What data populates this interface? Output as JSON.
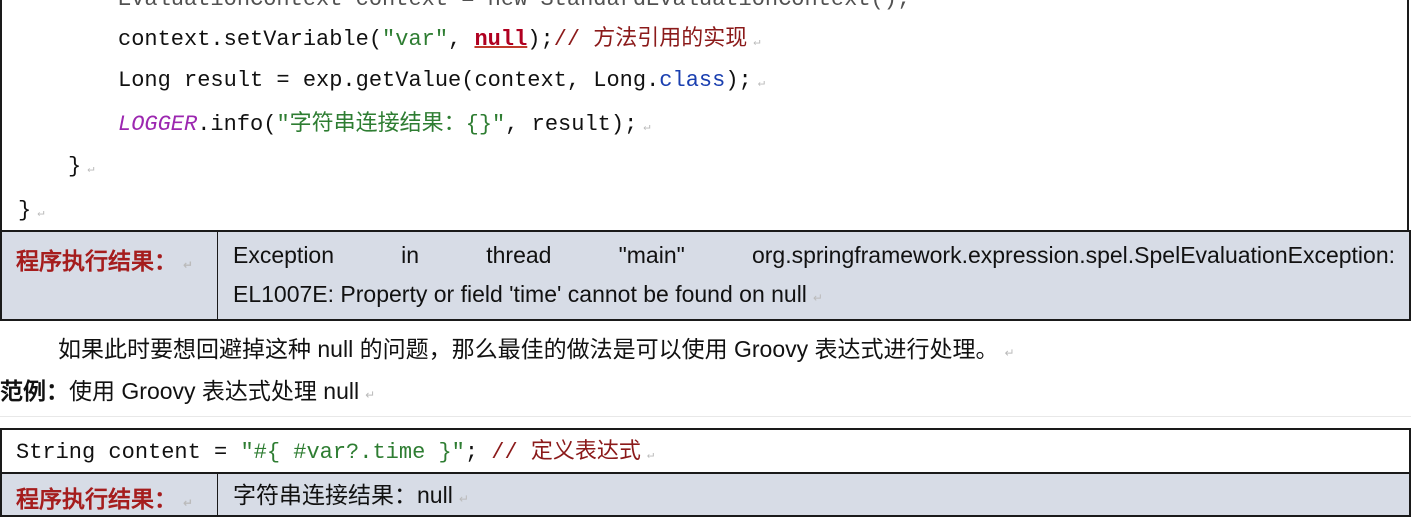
{
  "code_top": {
    "line0": "EvaluationContext context = new StandardEvaluationContext();",
    "line1": {
      "pre": "context.setVariable(",
      "str": "\"var\"",
      "comma": ", ",
      "null_kw": "null",
      "post": ");",
      "comment": "// 方法引用的实现"
    },
    "line2": {
      "pre": "Long result = exp.getValue(context, Long.",
      "kw": "class",
      "post": ");"
    },
    "line3": {
      "logger": "LOGGER",
      "call": ".info(",
      "str": "\"字符串连接结果：{}\"",
      "post": ", result);"
    },
    "line4": "}",
    "line5": "}"
  },
  "result1": {
    "label": "程序执行结果：",
    "words": [
      "Exception",
      "in",
      "thread",
      "\"main\"",
      "org.springframework.expression.spel.SpelEvaluationException:"
    ],
    "line2": "EL1007E: Property or field 'time' cannot be found on null"
  },
  "paragraph": "如果此时要想回避掉这种 null 的问题，那么最佳的做法是可以使用 Groovy 表达式进行处理。",
  "example": {
    "label": "范例：",
    "text": "使用 Groovy 表达式处理 null"
  },
  "code_bottom": {
    "pre": "String content = ",
    "str": "\"#{ #var?.time }\"",
    "post": "; ",
    "comment": "// 定义表达式"
  },
  "result2": {
    "label": "程序执行结果：",
    "value": "字符串连接结果：null"
  },
  "paragraph_mark": "↵"
}
